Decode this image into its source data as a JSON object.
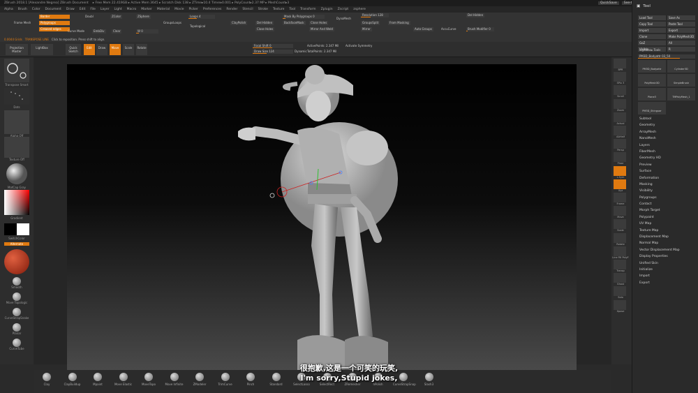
{
  "titlebar": {
    "app_title": "ZBrush 2018.1 [Alexandre Negrea]   ZBrush Document",
    "stats": "▸ Free Mem 22.419GB ▸ Active Mem 3645 ▸ Scratch Disk 138 ▸ ZTime▸10.4 Timer▸0.001 ▸ PolyCount▸2.37 MP ▸ MeshCount▸3",
    "quicksave": "QuickSave",
    "seethrough": "See-through 0",
    "menus": "Menus",
    "defaultscript": "DefaultZScript"
  },
  "menubar": [
    "Alpha",
    "Brush",
    "Color",
    "Document",
    "Draw",
    "Edit",
    "File",
    "Layer",
    "Light",
    "Macro",
    "Marker",
    "Material",
    "Movie",
    "Picker",
    "Preferences",
    "Render",
    "Stencil",
    "Stroke",
    "Texture",
    "Tool",
    "Transform",
    "Zplugin",
    "Zscript",
    "zsphere"
  ],
  "palette": {
    "frame_mesh": "Frame Mesh",
    "border": "Border",
    "polygroups": "Polygroups",
    "creased_edges": "Creased edges",
    "curve_mode": "Curve Mode",
    "doubl": "Doubl",
    "zcolor": "ZColor",
    "zsphere": "ZSphere",
    "groups_loops": "GroupsLoops",
    "loops": "Loops 4",
    "topological": "Topological",
    "emboss": "EmbDiv",
    "clear": "Clear",
    "wi": "W 0",
    "clay_polish": "ClayPolish",
    "del_hidden": "Del Hidden",
    "close_holes": "Close Holes",
    "mask_by_polygroups": "Mask By Polygroups 0",
    "back_face_mask": "BackfaceMask",
    "mirror_and_weld": "Mirror And Weld",
    "dynamesh": "DynaMesh",
    "resolution": "Resolution 128",
    "groups_split": "GroupsSplit",
    "from_masking": "From Masking",
    "mirror": "Mirror",
    "auto_groups": "Auto Groups",
    "accucurve": "AccuCurve",
    "del_hidden2": "Del Hidden",
    "brush_modifier": "Brush Modifier 0"
  },
  "statusbar": {
    "value": "0.0044 Grids",
    "mode": "TRANSPOSE LINE",
    "hint": "Click to reposition. Press shift to align."
  },
  "shelf": {
    "projection_master": "Projection Master",
    "lightbox": "LightBox",
    "quick_sketch": "Quick Sketch",
    "edit": "Edit",
    "draw": "Draw",
    "move": "Move",
    "scale": "Scale",
    "rotate": "Rotate",
    "focal_shift": "Focal Shift 0",
    "draw_size": "Draw Size 124",
    "dynamic": "Dynamic",
    "active_points": "ActivePoints: 2.347 Mil",
    "total_points": "TotalPoints: 2.347 Mil",
    "activate_symmetry": "Activate Symmetry"
  },
  "lefttray": {
    "brush_label": "Transpose Smart",
    "stroke_label": "Dots",
    "alpha_label": "Alpha Off",
    "texture_label": "Texture Off",
    "material_label": "MatCap Gray",
    "gradient": "Gradient",
    "switch_color": "SwitchColor",
    "alternate": "Alternate",
    "brushes": [
      "Smooth",
      "Move Topologic",
      "CurveStrapSnake",
      "Planar",
      "CurveTube"
    ]
  },
  "righttray": [
    "BPR",
    "SPix 3",
    "Scroll",
    "Zoom",
    "Actual",
    "AAHalf",
    "Persp",
    "Floor",
    "L.Sym",
    "Xyz",
    "Frame",
    "Move",
    "Scale",
    "Rotate",
    "Line Fill PolyF",
    "Transp",
    "Ghost",
    "Solo",
    "Xpose"
  ],
  "toolpanel": {
    "title": "Tool",
    "buttons": [
      "Load Tool",
      "Save As",
      "Copy Tool",
      "Paste Tool",
      "Import",
      "Export",
      "Clone",
      "Make PolyMesh3D",
      "GoZ",
      "All",
      "Visible",
      "R"
    ],
    "lightbox_tools": "Lightbox▸ Tools",
    "current_tool": "PM3D_Bodyattr 03_50",
    "thumbs": [
      "PM3D_Bodyattr",
      "Cylinder3D",
      "PolyMesh3D",
      "SimpleBrush",
      "Plane3",
      "TMPolyMesh_1",
      "PM3D_Shinguar"
    ],
    "subpalettes": [
      "Subtool",
      "Geometry",
      "ArrayMesh",
      "NanoMesh",
      "Layers",
      "FiberMesh",
      "Geometry HD",
      "Preview",
      "Surface",
      "Deformation",
      "Masking",
      "Visibility",
      "Polygroups",
      "Contact",
      "Morph Target",
      "Polypaint",
      "UV Map",
      "Texture Map",
      "Displacement Map",
      "Normal Map",
      "Vector Displacement Map",
      "Display Properties",
      "Unified Skin",
      "Initialize",
      "Import",
      "Export"
    ]
  },
  "bottomshelf": [
    "Clay",
    "ClayBuildup",
    "Mpaint",
    "Move Elastic",
    "MoveTopo",
    "Move Infinite",
    "ZModeler",
    "TrimCurve",
    "Pinch",
    "Standard",
    "SelectLasso",
    "SelectRect",
    "ZRemesher",
    "hPolish",
    "CurveStrapSnap",
    "Slash3"
  ],
  "subtitles": {
    "chinese": "很抱歉,这是一个可笑的玩笑,",
    "english": "I'm sorry,Stupid jokes,"
  },
  "colors": {
    "accent": "#e07a10",
    "bg": "#2a2a2a"
  }
}
